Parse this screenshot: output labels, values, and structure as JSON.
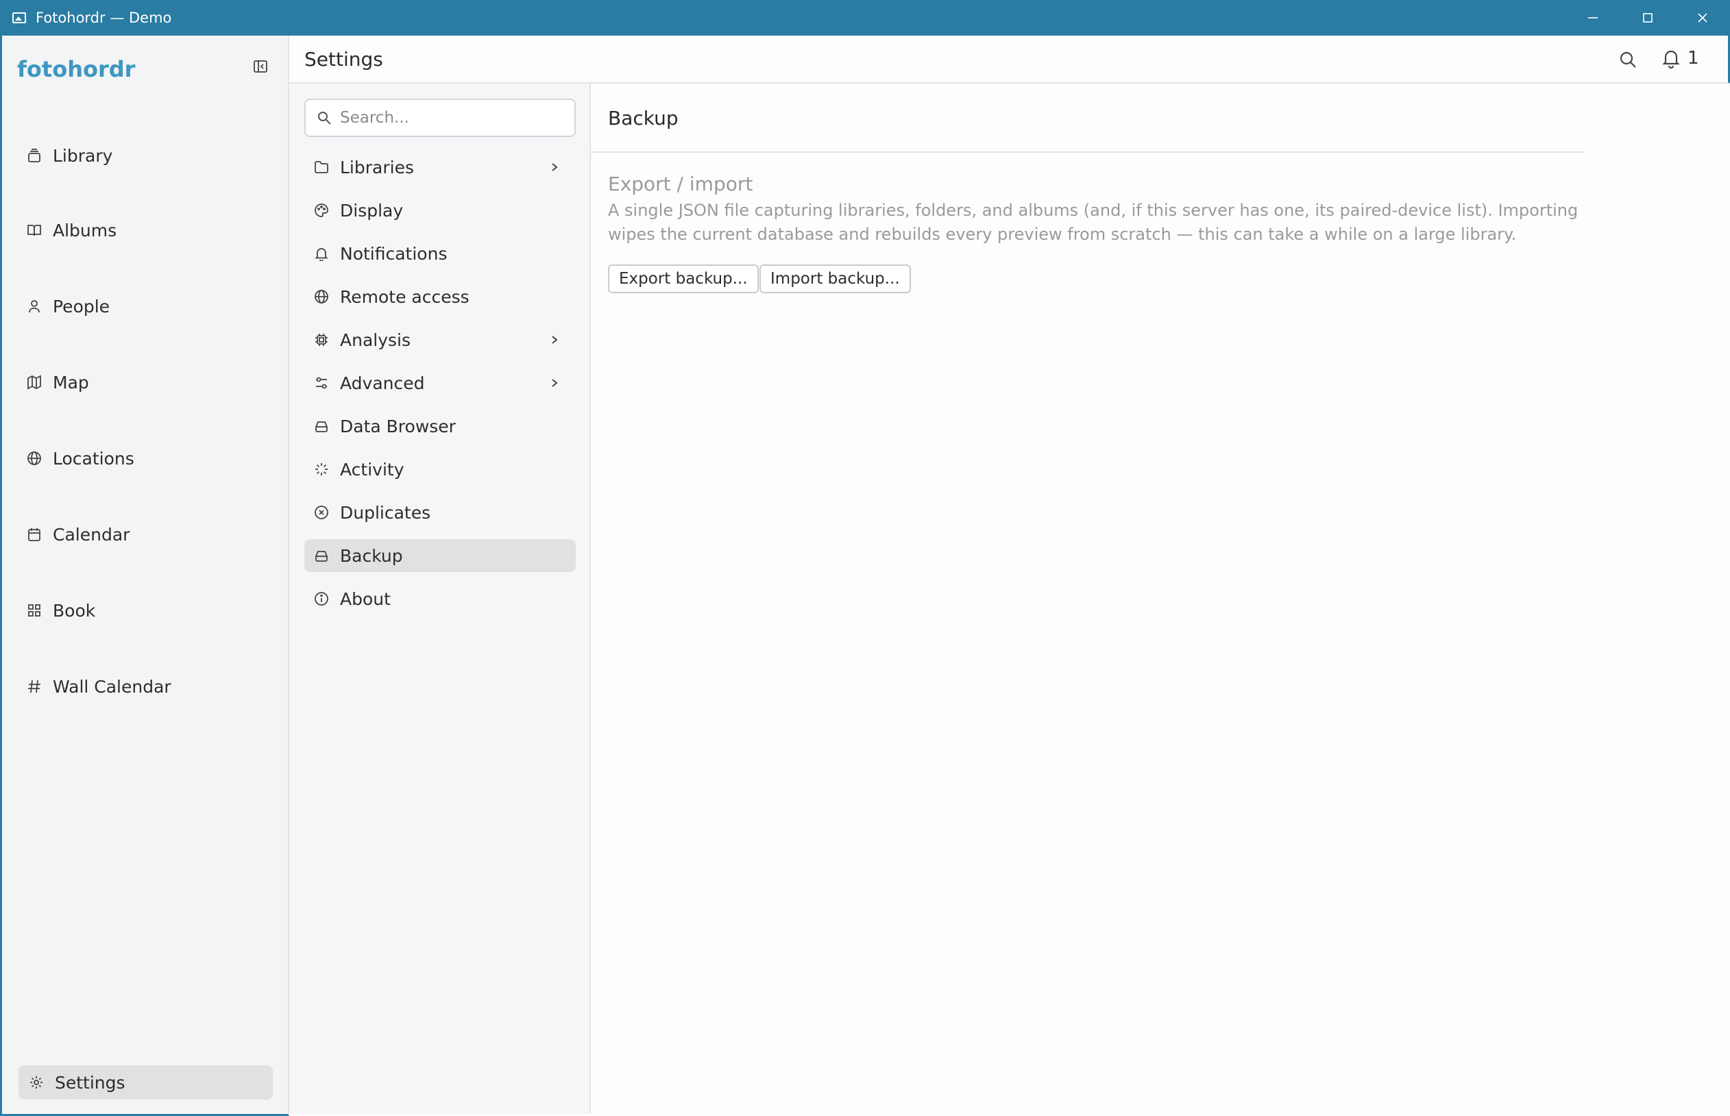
{
  "window": {
    "title": "Fotohordr — Demo"
  },
  "sidebar": {
    "brand": "fotohordr",
    "items": [
      {
        "label": "Library",
        "icon": "library-icon"
      },
      {
        "label": "Albums",
        "icon": "book-open-icon"
      },
      {
        "label": "People",
        "icon": "person-icon"
      },
      {
        "label": "Map",
        "icon": "map-icon"
      },
      {
        "label": "Locations",
        "icon": "globe-icon"
      },
      {
        "label": "Calendar",
        "icon": "calendar-icon"
      },
      {
        "label": "Book",
        "icon": "grid-icon"
      },
      {
        "label": "Wall Calendar",
        "icon": "hash-icon"
      }
    ],
    "settings_label": "Settings"
  },
  "header": {
    "title": "Settings",
    "notification_count": "1"
  },
  "subnav": {
    "search_placeholder": "Search...",
    "items": [
      {
        "label": "Libraries",
        "has_submenu": true
      },
      {
        "label": "Display",
        "has_submenu": false
      },
      {
        "label": "Notifications",
        "has_submenu": false
      },
      {
        "label": "Remote access",
        "has_submenu": false
      },
      {
        "label": "Analysis",
        "has_submenu": true
      },
      {
        "label": "Advanced",
        "has_submenu": true
      },
      {
        "label": "Data Browser",
        "has_submenu": false
      },
      {
        "label": "Activity",
        "has_submenu": false
      },
      {
        "label": "Duplicates",
        "has_submenu": false
      },
      {
        "label": "Backup",
        "has_submenu": false,
        "active": true
      },
      {
        "label": "About",
        "has_submenu": false
      }
    ]
  },
  "content": {
    "section_title": "Backup",
    "group_title": "Export / import",
    "group_description": "A single JSON file capturing libraries, folders, and albums (and, if this server has one, its paired-device list). Importing wipes the current database and rebuilds every preview from scratch — this can take a while on a large library.",
    "export_button": "Export backup...",
    "import_button": "Import backup..."
  },
  "colors": {
    "titlebar": "#2a7ca3",
    "brand": "#3d97c1",
    "active_bg": "#e0e1e3"
  }
}
